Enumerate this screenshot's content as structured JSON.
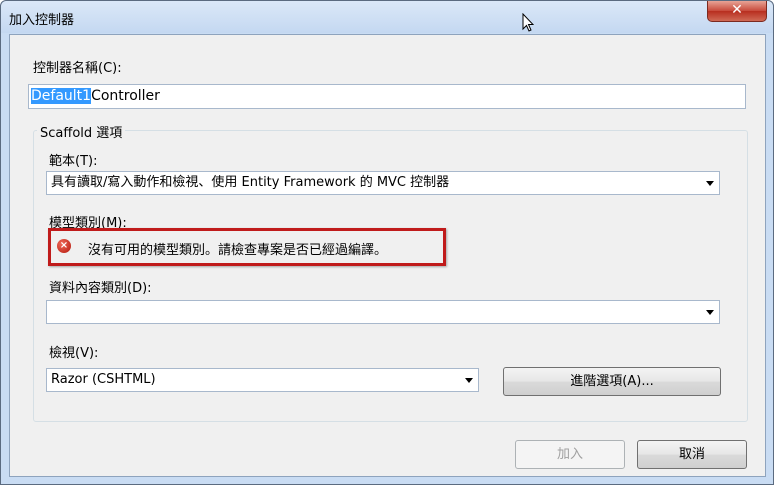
{
  "window": {
    "title": "加入控制器",
    "close_glyph": "✕"
  },
  "controller_name": {
    "label": "控制器名稱(C):",
    "value_selected": "Default1",
    "value_rest": "Controller"
  },
  "scaffold": {
    "group_title": "Scaffold 選項",
    "template": {
      "label": "範本(T):",
      "value": "具有讀取/寫入動作和檢視、使用 Entity Framework 的 MVC 控制器"
    },
    "model_class": {
      "label": "模型類別(M):",
      "error_icon": "error-icon",
      "error_glyph": "×",
      "error_message": "沒有可用的模型類別。請檢查專案是否已經過編譯。"
    },
    "data_context": {
      "label": "資料內容類別(D):",
      "value": ""
    },
    "views": {
      "label": "檢視(V):",
      "value": "Razor (CSHTML)",
      "advanced_button": "進階選項(A)..."
    }
  },
  "buttons": {
    "add": "加入",
    "cancel": "取消"
  },
  "colors": {
    "title_bar": "#c4d8f1",
    "error_border": "#c01b1b",
    "selection": "#3399ff",
    "close_button": "#c7493a"
  }
}
